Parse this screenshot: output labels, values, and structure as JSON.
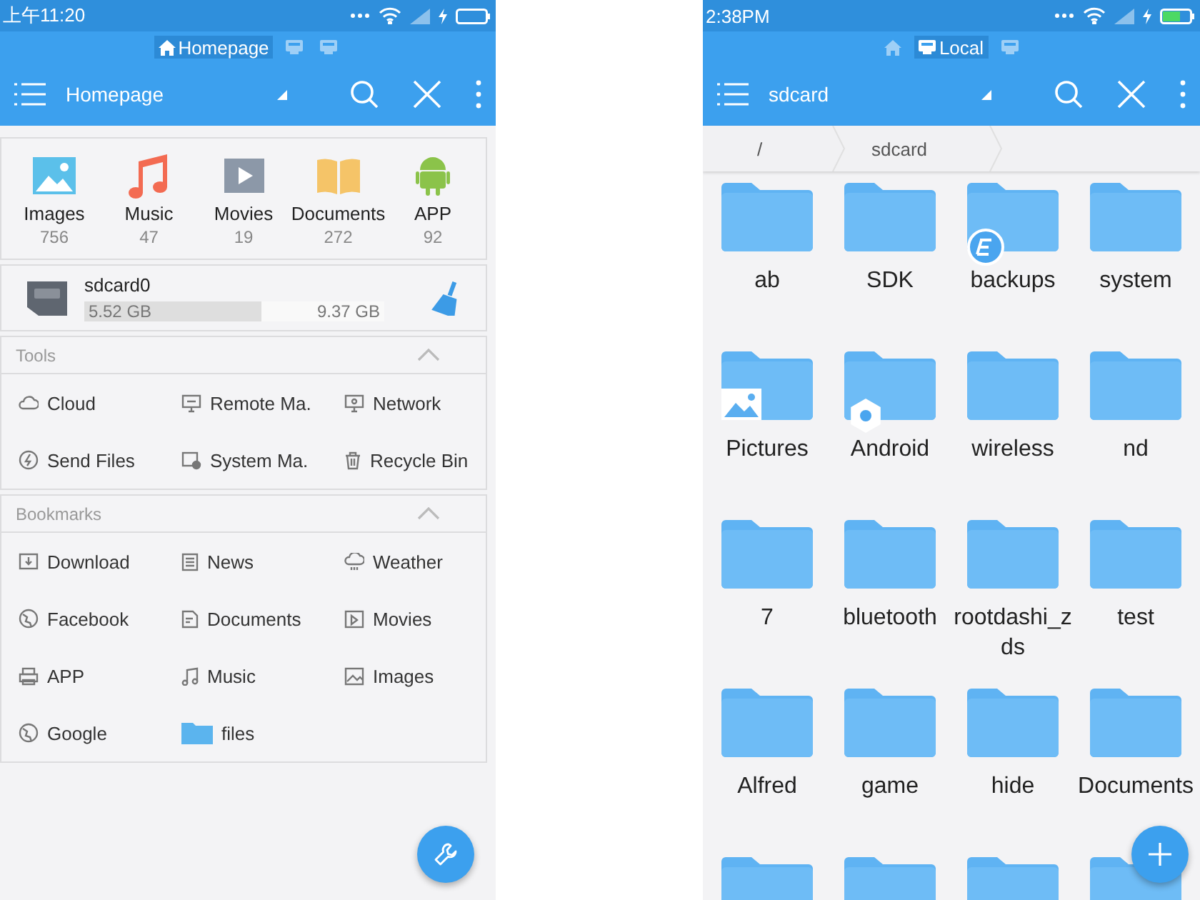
{
  "left_phone": {
    "status_bar": {
      "time": "上午11:20"
    },
    "window_tabs": [
      {
        "kind": "home",
        "label": "Homepage",
        "selected": true
      },
      {
        "kind": "window",
        "selected": false
      },
      {
        "kind": "window",
        "selected": false
      }
    ],
    "toolbar": {
      "title": "Homepage"
    },
    "categories": [
      {
        "label": "Images",
        "count": "756"
      },
      {
        "label": "Music",
        "count": "47"
      },
      {
        "label": "Movies",
        "count": "19"
      },
      {
        "label": "Documents",
        "count": "272"
      },
      {
        "label": "APP",
        "count": "92"
      }
    ],
    "storage": {
      "name": "sdcard0",
      "used": "5.52 GB",
      "total": "9.37 GB",
      "level": 0.59
    },
    "sections": [
      {
        "title": "Tools",
        "expanded": true,
        "items": [
          "Cloud",
          "Remote Ma.",
          "Network",
          "Send Files",
          "System Ma.",
          "Recycle Bin"
        ]
      },
      {
        "title": "Bookmarks",
        "expanded": true,
        "items": [
          "Download",
          "News",
          "Weather",
          "Facebook",
          "Documents",
          "Movies",
          "APP",
          "Music",
          "Images",
          "Google",
          "files"
        ]
      }
    ]
  },
  "right_phone": {
    "status_bar": {
      "time": "2:38PM"
    },
    "window_tabs": [
      {
        "kind": "home",
        "selected": false
      },
      {
        "kind": "window",
        "label": "Local",
        "selected": true
      },
      {
        "kind": "window",
        "selected": false
      }
    ],
    "toolbar": {
      "title": "sdcard"
    },
    "breadcrumb": [
      "/",
      "sdcard"
    ],
    "folders": [
      {
        "name": "ab",
        "kind": "plain"
      },
      {
        "name": "SDK",
        "kind": "plain"
      },
      {
        "name": "backups",
        "kind": "app"
      },
      {
        "name": "system",
        "kind": "plain"
      },
      {
        "name": "Pictures",
        "kind": "pictures"
      },
      {
        "name": "Android",
        "kind": "system"
      },
      {
        "name": "wireless",
        "kind": "plain"
      },
      {
        "name": "nd",
        "kind": "plain"
      },
      {
        "name": "7",
        "kind": "plain"
      },
      {
        "name": "bluetooth",
        "kind": "plain"
      },
      {
        "name": "rootdashi_zds",
        "kind": "plain"
      },
      {
        "name": "test",
        "kind": "plain"
      },
      {
        "name": "Alfred",
        "kind": "plain"
      },
      {
        "name": "game",
        "kind": "plain"
      },
      {
        "name": "hide",
        "kind": "plain"
      },
      {
        "name": "Documents",
        "kind": "plain"
      },
      {
        "kind": "plain"
      },
      {
        "kind": "plain"
      },
      {
        "kind": "plain"
      },
      {
        "kind": "plain"
      }
    ]
  }
}
